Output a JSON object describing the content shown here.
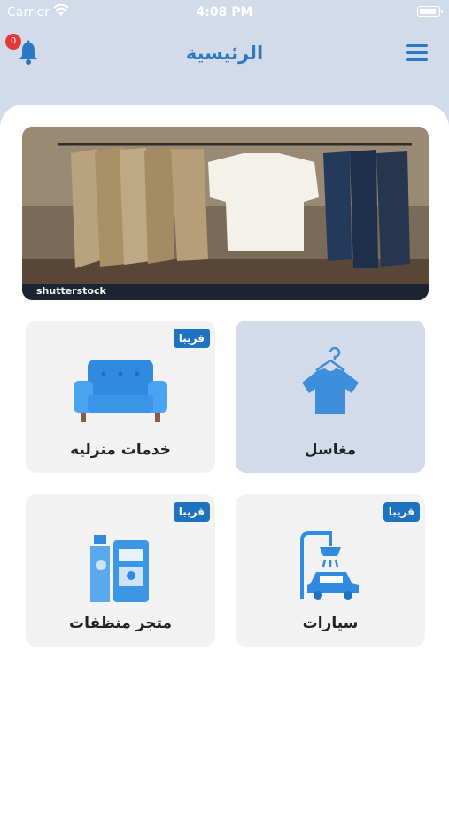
{
  "status": {
    "carrier": "Carrier",
    "time": "4:08 PM"
  },
  "header": {
    "title": "الرئيسية",
    "notification_count": "0"
  },
  "banner": {
    "caption": "shutterstock"
  },
  "cards": [
    {
      "label": "مغاسل",
      "badge": ""
    },
    {
      "label": "خدمات منزليه",
      "badge": "قريبا"
    },
    {
      "label": "سيارات",
      "badge": "قريبا"
    },
    {
      "label": "متجر منظفات",
      "badge": "قريبا"
    }
  ],
  "colors": {
    "accent": "#2b79c2",
    "badge_bg": "#1d73bf",
    "active_card": "#d3dae9",
    "card": "#f2f2f2"
  }
}
